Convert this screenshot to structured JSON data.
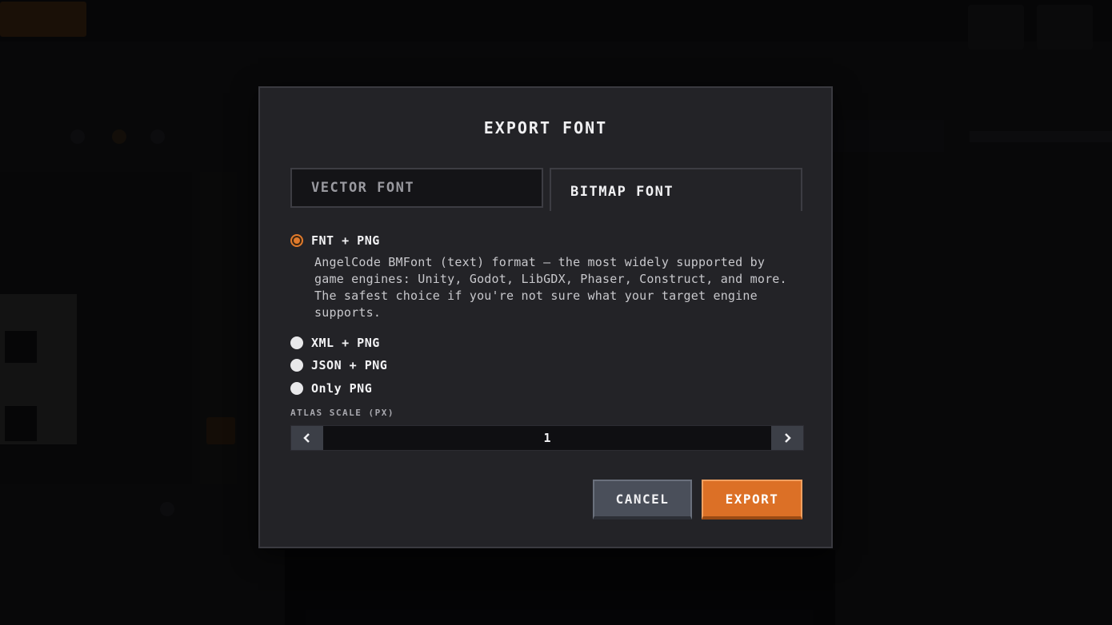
{
  "modal": {
    "title": "EXPORT FONT",
    "tabs": [
      {
        "label": "VECTOR FONT",
        "active": false
      },
      {
        "label": "BITMAP FONT",
        "active": true
      }
    ],
    "options": [
      {
        "label": "FNT + PNG",
        "selected": true,
        "description": "AngelCode BMFont (text) format — the most widely supported by game engines: Unity, Godot, LibGDX, Phaser, Construct, and more. The safest choice if you're not sure what your target engine supports."
      },
      {
        "label": "XML + PNG",
        "selected": false
      },
      {
        "label": "JSON + PNG",
        "selected": false
      },
      {
        "label": "Only PNG",
        "selected": false
      }
    ],
    "atlas_scale": {
      "label": "ATLAS SCALE (PX)",
      "value": "1",
      "decrement_icon": "chevron-left-icon",
      "increment_icon": "chevron-right-icon"
    },
    "buttons": {
      "cancel_label": "CANCEL",
      "export_label": "EXPORT"
    }
  },
  "colors": {
    "accent": "#dc7026",
    "modal_bg": "#232327",
    "overlay": "#000000"
  }
}
